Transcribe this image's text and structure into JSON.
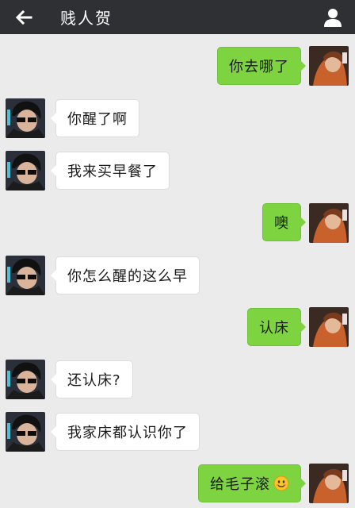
{
  "header": {
    "back_icon": "arrow-left-icon",
    "title": "贱人贺",
    "profile_icon": "person-icon",
    "bg_color": "#2e3034"
  },
  "colors": {
    "outgoing_bubble": "#7ed341",
    "incoming_bubble": "#ffffff",
    "chat_background": "#ebebeb"
  },
  "messages": [
    {
      "side": "out",
      "text": "你去哪了"
    },
    {
      "side": "in",
      "text": "你醒了啊"
    },
    {
      "side": "in",
      "text": "我来买早餐了"
    },
    {
      "side": "out",
      "text": "噢"
    },
    {
      "side": "in",
      "text": "你怎么醒的这么早"
    },
    {
      "side": "out",
      "text": "认床"
    },
    {
      "side": "in",
      "text": "还认床?"
    },
    {
      "side": "in",
      "text": "我家床都认识你了"
    },
    {
      "side": "out",
      "text": "给毛子滚",
      "emoji": "smiley-emoji-icon"
    }
  ]
}
